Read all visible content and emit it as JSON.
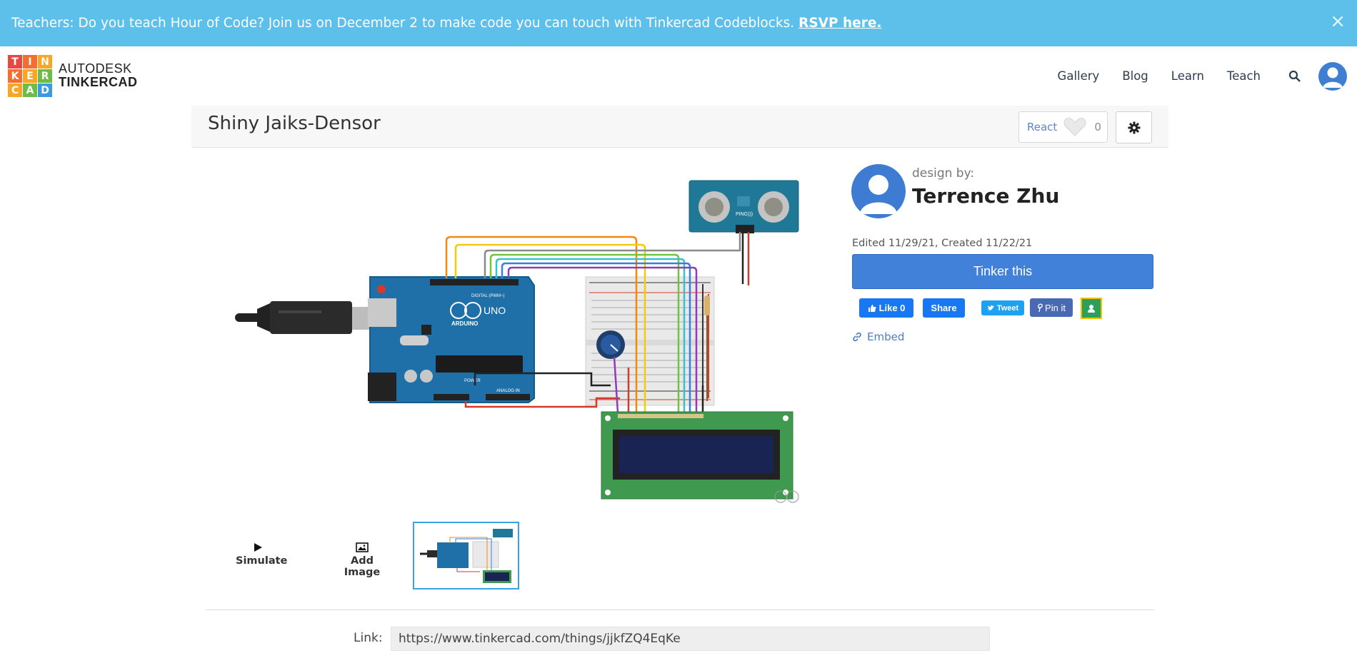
{
  "banner": {
    "text": "Teachers: Do you teach Hour of Code? Join us on December 2 to make code you can touch with Tinkercad Codeblocks.",
    "link": "RSVP here.",
    "close": "×"
  },
  "logo": {
    "letters": [
      "T",
      "I",
      "N",
      "K",
      "E",
      "R",
      "C",
      "A",
      "D"
    ],
    "line1": "AUTODESK",
    "line2": "TINKERCAD"
  },
  "nav": {
    "items": [
      "Gallery",
      "Blog",
      "Learn",
      "Teach"
    ]
  },
  "design": {
    "title": "Shiny Jaiks-Densor",
    "react_label": "React",
    "react_count": "0",
    "by_label": "design by:",
    "author": "Terrence Zhu",
    "dates": "Edited 11/29/21, Created 11/22/21",
    "tinker_button": "Tinker this",
    "embed_label": "Embed"
  },
  "share": {
    "like": "Like 0",
    "share": "Share",
    "tweet": "Tweet",
    "pin": "Pin it"
  },
  "tools": {
    "simulate": "Simulate",
    "add_image": "Add Image"
  },
  "link": {
    "label": "Link:",
    "url": "https://www.tinkercad.com/things/jjkfZQ4EqKe"
  },
  "circuit": {
    "board_label": "UNO",
    "brand_label": "ARDUINO",
    "sensor_label": "PING)))",
    "digital_label": "DIGITAL (PWM~)",
    "analog_label": "ANALOG IN",
    "power_label": "POWER"
  },
  "colors": {
    "banner": "#5cc0eb",
    "primary": "#4181da",
    "arduino": "#1f6fa8",
    "lcd_board": "#3f9a4f",
    "lcd_screen": "#1a2452"
  }
}
